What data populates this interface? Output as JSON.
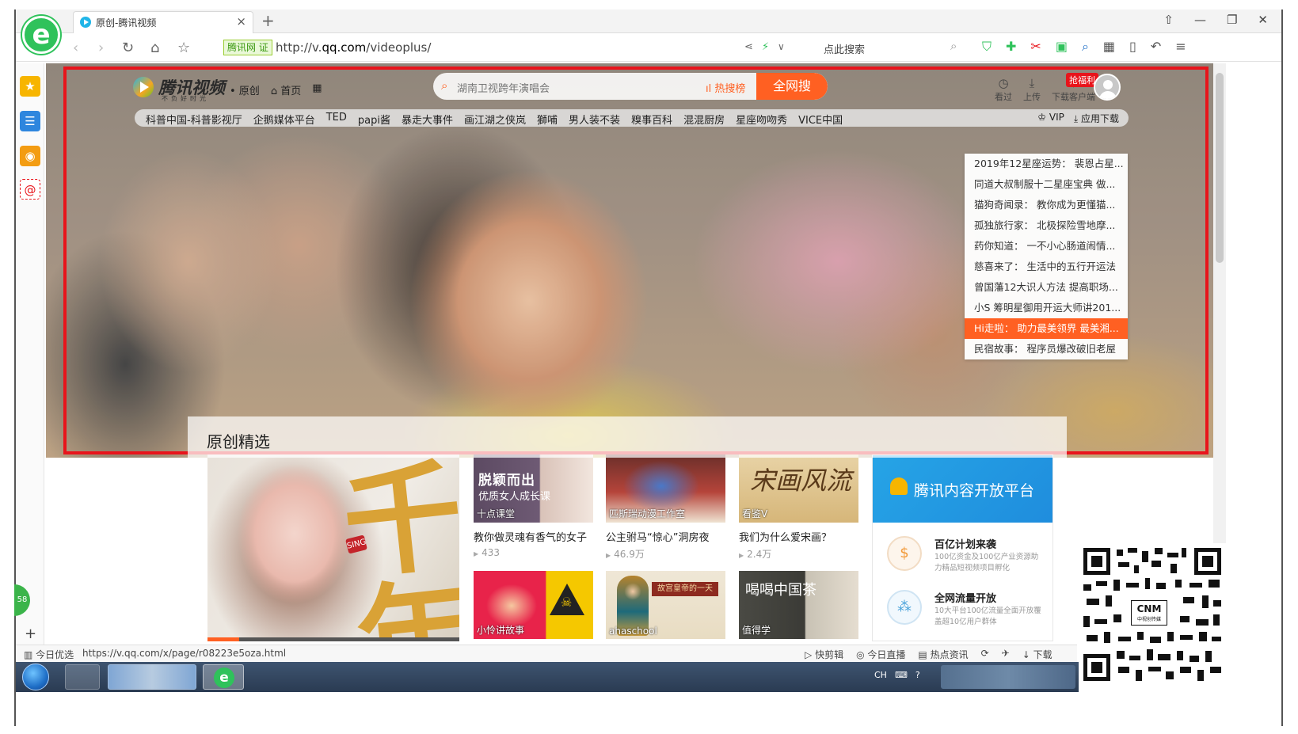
{
  "browser": {
    "tab_title": "原创-腾讯视频",
    "tab_close": "×",
    "new_tab": "+",
    "window_buttons": [
      "⇧",
      "—",
      "❐",
      "✕"
    ],
    "site_badge": "腾讯网",
    "url_prefix": "http://v.",
    "url_domain": "qq.com",
    "url_path": "/videoplus/",
    "search_hint": "点此搜索",
    "nav_icons": [
      "back-icon",
      "forward-icon",
      "refresh-icon",
      "home-icon",
      "star-icon"
    ]
  },
  "page": {
    "logo_name": "腾讯视频",
    "logo_slogan": "不负好时光",
    "nav": [
      "• 原创",
      "⌂ 首页"
    ],
    "search_placeholder": "湖南卫视跨年演唱会",
    "hot_rank": "热搜榜",
    "search_button": "全网搜",
    "tools": [
      {
        "label": "看过"
      },
      {
        "label": "上传"
      },
      {
        "label": "下载客户端"
      }
    ],
    "coupon": "抢福利",
    "channels": [
      "科普中国-科普影视厅",
      "企鹅媒体平台",
      "TED",
      "papi酱",
      "暴走大事件",
      "画江湖之侠岚",
      "獅哺",
      "男人装不装",
      "糗事百科",
      "混混厨房",
      "星座吻吻秀",
      "VICE中国"
    ],
    "vip": "VIP",
    "app_download": "应用下载",
    "dropdown": [
      "2019年12星座运势： 裴恩占星...",
      "同道大叔制服十二星座宝典 做...",
      "猫狗奇闻录： 教你成为更懂猫...",
      "孤独旅行家： 北极探险雪地摩...",
      "药你知道： 一不小心肠道闹情...",
      "慈喜来了： 生活中的五行开运法",
      "曾国藩12大识人方法 提高职场...",
      "小S 筹明星御用开运大师讲201...",
      "Hi走啦： 助力最美领界 最美湘...",
      "民宿故事： 程序员爆改破旧老屋"
    ],
    "dropdown_active": 8,
    "featured_title": "原创精选",
    "big_card": {
      "char": "千年",
      "sing": "SING"
    },
    "videos": [
      {
        "thumb_big": "脱颖而出",
        "thumb_sub": "优质女人成长课",
        "tag": "十点课堂",
        "title": "教你做灵魂有香气的女子",
        "plays": "433"
      },
      {
        "thumb_big": "",
        "thumb_sub": "",
        "tag": "匹斯瑞动漫工作室",
        "title": "公主驸马“惊心”洞房夜",
        "plays": "46.9万"
      },
      {
        "thumb_big": "宋画风流",
        "thumb_sub": "",
        "tag": "看鉴V",
        "title": "我们为什么爱宋画？",
        "plays": "2.4万"
      },
      {
        "thumb_big": "",
        "thumb_sub": "",
        "tag": "小怜讲故事",
        "title": "",
        "plays": ""
      },
      {
        "thumb_big": "故宫皇帝的一天",
        "thumb_sub": "",
        "tag": "ahaschool",
        "title": "",
        "plays": ""
      },
      {
        "thumb_big": "喝喝中国茶",
        "thumb_sub": "",
        "tag": "值得学",
        "title": "",
        "plays": ""
      }
    ],
    "promo": {
      "title": "腾讯内容开放平台",
      "rows": [
        {
          "title": "百亿计划来袭",
          "desc": "100亿资金及100亿产业资源助力精品短视频项目孵化"
        },
        {
          "title": "全网流量开放",
          "desc": "10大平台100亿流量全面开放覆盖超10亿用户群体"
        }
      ]
    },
    "qr_label": "CNM",
    "qr_sub": "中视创传媒"
  },
  "sidebar": {
    "green_tab": "58",
    "plus": "+"
  },
  "status": {
    "left": "今日优选",
    "url": "https://v.qq.com/x/page/r08223e5oza.html",
    "right": [
      "快剪辑",
      "今日直播",
      "热点资讯",
      "下载"
    ]
  },
  "taskbar": {
    "tray": [
      "CH",
      "⌨",
      "?"
    ]
  },
  "colors": {
    "accent_orange": "#ff6022",
    "highlight_red": "#e8141b",
    "browser_green": "#2fc25b",
    "promo_blue": "#26a4e6"
  }
}
